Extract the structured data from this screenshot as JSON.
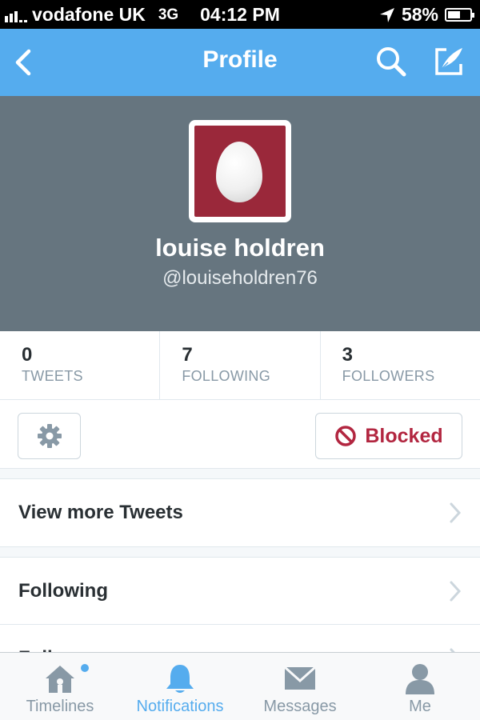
{
  "status_bar": {
    "carrier": "vodafone UK",
    "network": "3G",
    "time": "04:12 PM",
    "battery": "58%",
    "battery_level": 0.58
  },
  "nav": {
    "title": "Profile",
    "icons": [
      "back-chevron-icon",
      "search-icon",
      "compose-icon"
    ]
  },
  "profile": {
    "name": "louise holdren",
    "handle": "@louiseholdren76",
    "avatar": "egg-avatar"
  },
  "stats": [
    {
      "count": "0",
      "label": "TWEETS"
    },
    {
      "count": "7",
      "label": "FOLLOWING"
    },
    {
      "count": "3",
      "label": "FOLLOWERS"
    }
  ],
  "actions": {
    "settings_icon": "gear-icon",
    "blocked_label": "Blocked"
  },
  "list": {
    "view_more_tweets": "View more Tweets",
    "following": "Following",
    "followers": "Followers"
  },
  "tabs": [
    {
      "label": "Timelines",
      "icon": "home-icon",
      "active": false,
      "dot": true
    },
    {
      "label": "Notifications",
      "icon": "bell-icon",
      "active": true,
      "dot": false
    },
    {
      "label": "Messages",
      "icon": "envelope-icon",
      "active": false,
      "dot": false
    },
    {
      "label": "Me",
      "icon": "person-icon",
      "active": false,
      "dot": false
    }
  ],
  "colors": {
    "brand_blue": "#55acee",
    "header_gray": "#66757f",
    "avatar_bg": "#9a283a",
    "blocked_red": "#b22640"
  }
}
